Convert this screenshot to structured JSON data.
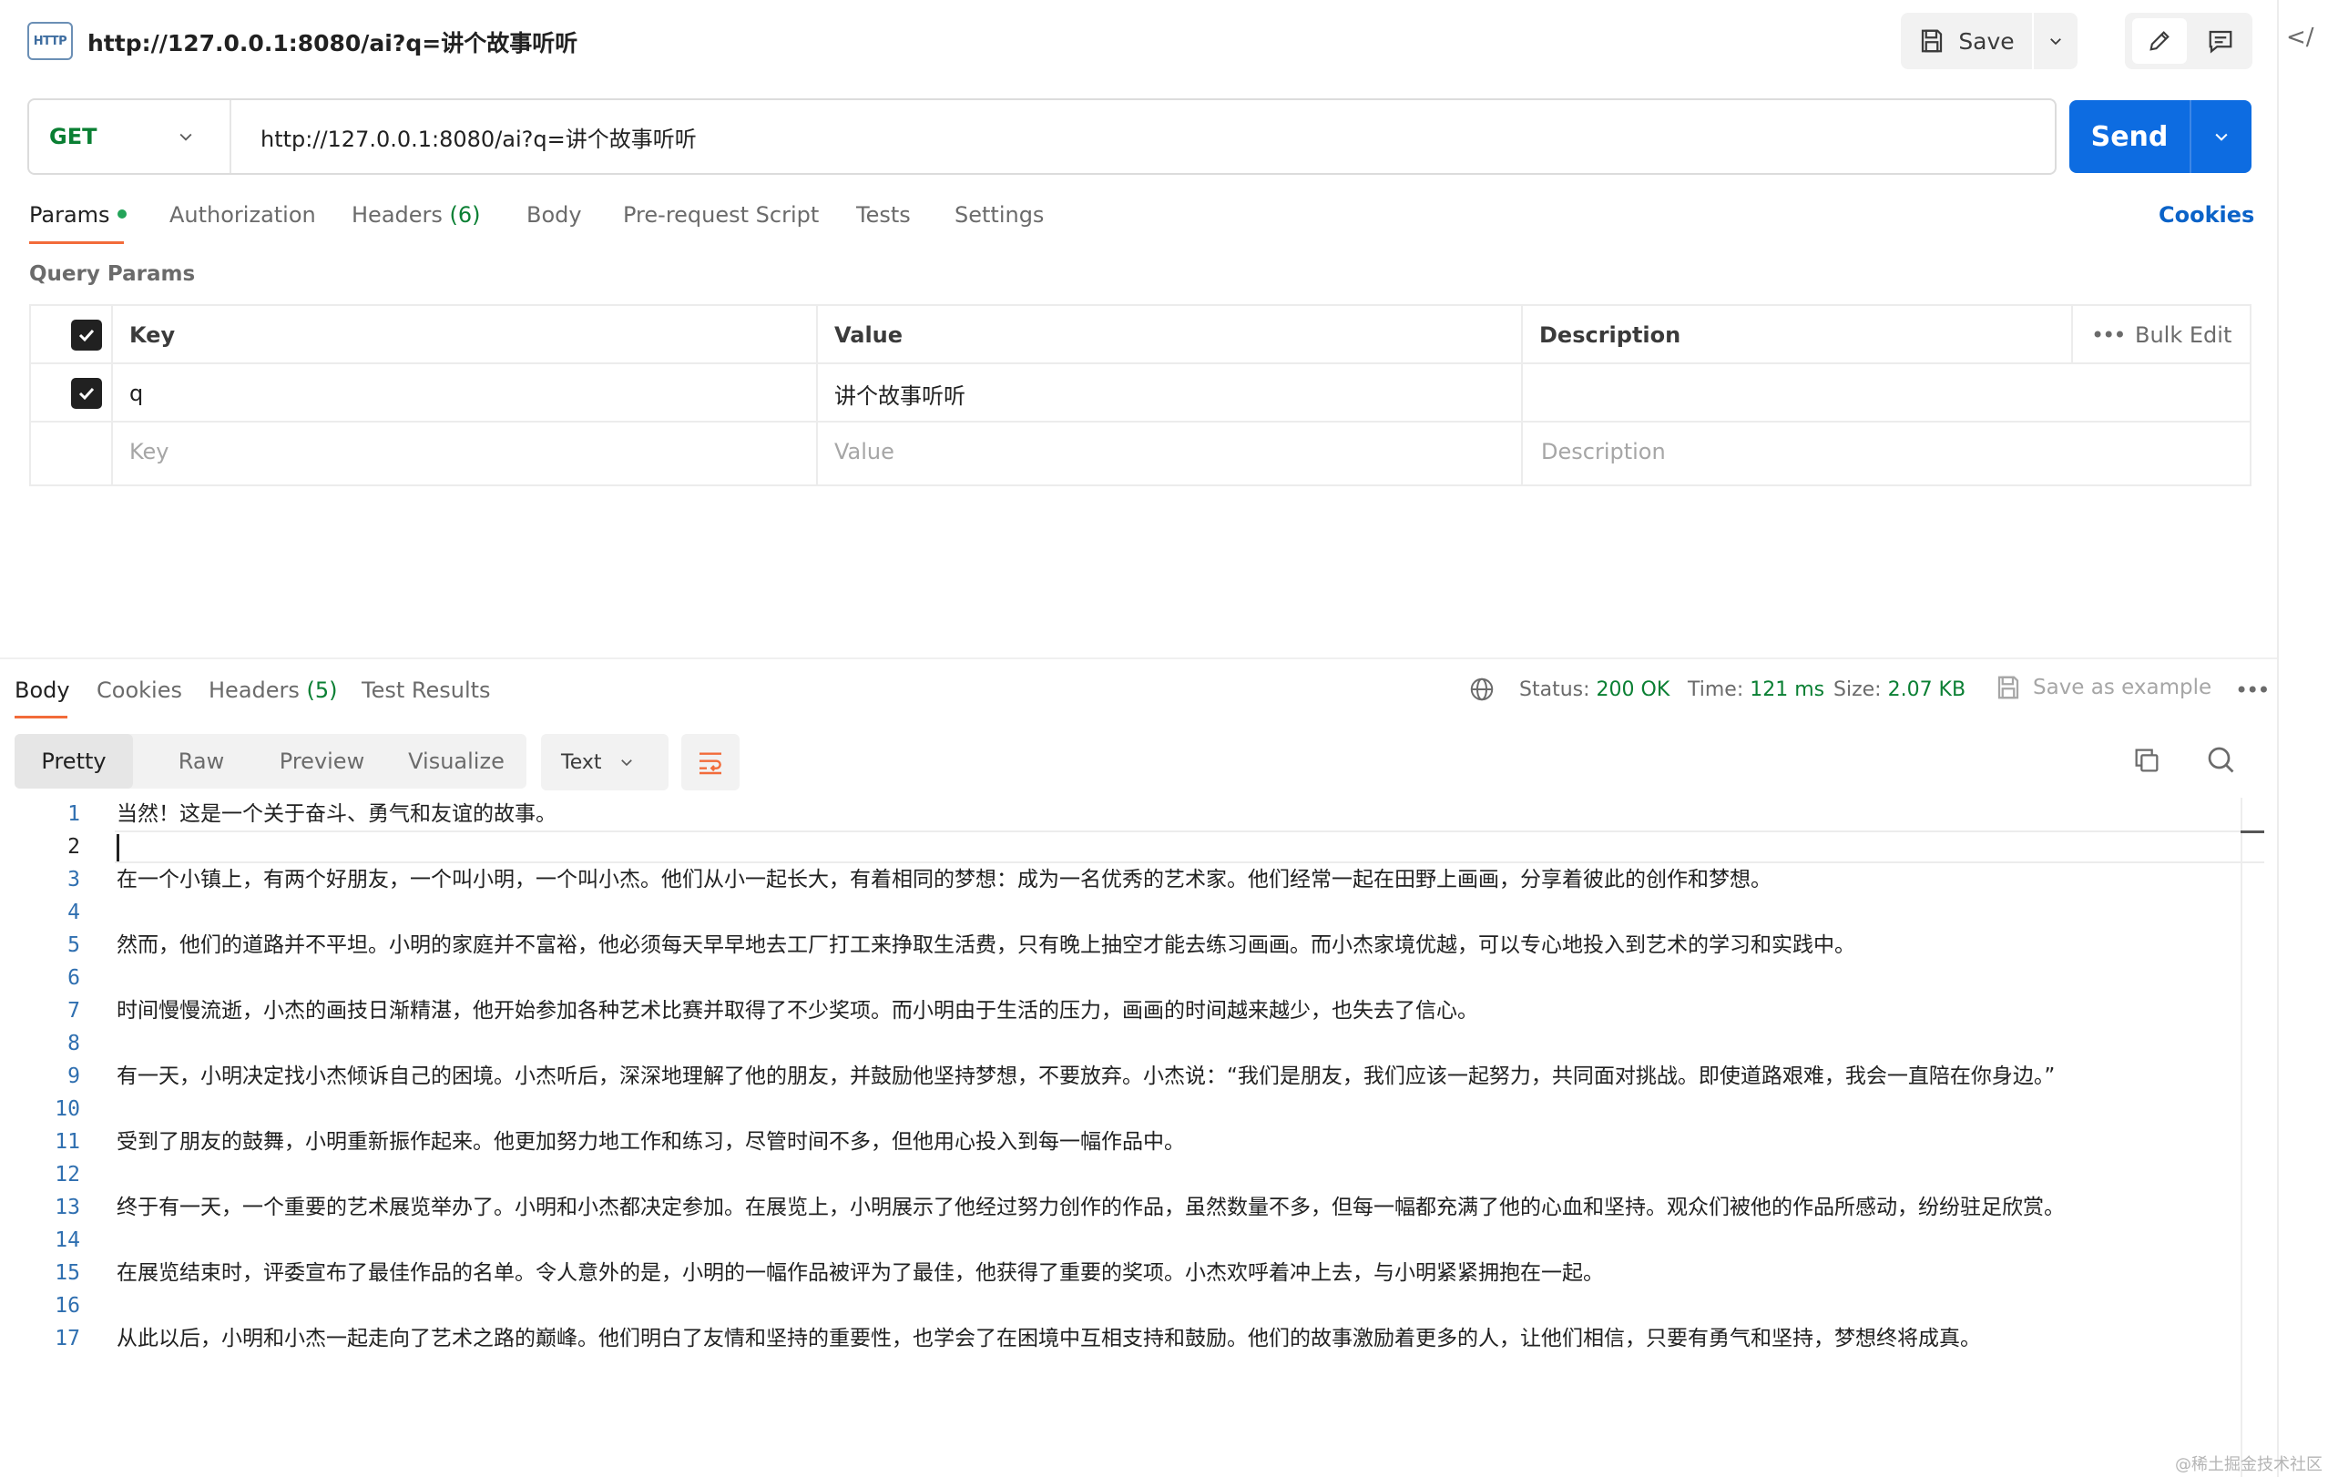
{
  "header": {
    "icon_label": "HTTP",
    "title": "http://127.0.0.1:8080/ai?q=讲个故事听听",
    "save_label": "Save",
    "code_toggle": "</"
  },
  "request": {
    "method": "GET",
    "url": "http://127.0.0.1:8080/ai?q=讲个故事听听",
    "send_label": "Send"
  },
  "request_tabs": {
    "params": "Params",
    "authorization": "Authorization",
    "headers": "Headers",
    "headers_count": "(6)",
    "body": "Body",
    "pre_request": "Pre-request Script",
    "tests": "Tests",
    "settings": "Settings",
    "cookies": "Cookies"
  },
  "query_params": {
    "title": "Query Params",
    "columns": {
      "key": "Key",
      "value": "Value",
      "description": "Description",
      "more": "•••",
      "bulk_edit": "Bulk Edit"
    },
    "rows": [
      {
        "key": "q",
        "value": "讲个故事听听",
        "description": ""
      }
    ],
    "placeholders": {
      "key": "Key",
      "value": "Value",
      "description": "Description"
    }
  },
  "response_tabs": {
    "body": "Body",
    "cookies": "Cookies",
    "headers": "Headers",
    "headers_count": "(5)",
    "test_results": "Test Results"
  },
  "response_status": {
    "status_label": "Status:",
    "status_value": "200 OK",
    "time_label": "Time:",
    "time_value": "121 ms",
    "size_label": "Size:",
    "size_value": "2.07 KB",
    "save_example": "Save as example",
    "more": "•••"
  },
  "format": {
    "pretty": "Pretty",
    "raw": "Raw",
    "preview": "Preview",
    "visualize": "Visualize",
    "type": "Text"
  },
  "body_lines": [
    "当然！这是一个关于奋斗、勇气和友谊的故事。",
    "",
    "在一个小镇上，有两个好朋友，一个叫小明，一个叫小杰。他们从小一起长大，有着相同的梦想：成为一名优秀的艺术家。他们经常一起在田野上画画，分享着彼此的创作和梦想。",
    "",
    "然而，他们的道路并不平坦。小明的家庭并不富裕，他必须每天早早地去工厂打工来挣取生活费，只有晚上抽空才能去练习画画。而小杰家境优越，可以专心地投入到艺术的学习和实践中。",
    "",
    "时间慢慢流逝，小杰的画技日渐精湛，他开始参加各种艺术比赛并取得了不少奖项。而小明由于生活的压力，画画的时间越来越少，也失去了信心。",
    "",
    "有一天，小明决定找小杰倾诉自己的困境。小杰听后，深深地理解了他的朋友，并鼓励他坚持梦想，不要放弃。小杰说：“我们是朋友，我们应该一起努力，共同面对挑战。即使道路艰难，我会一直陪在你身边。”",
    "",
    "受到了朋友的鼓舞，小明重新振作起来。他更加努力地工作和练习，尽管时间不多，但他用心投入到每一幅作品中。",
    "",
    "终于有一天，一个重要的艺术展览举办了。小明和小杰都决定参加。在展览上，小明展示了他经过努力创作的作品，虽然数量不多，但每一幅都充满了他的心血和坚持。观众们被他的作品所感动，纷纷驻足欣赏。",
    "",
    "在展览结束时，评委宣布了最佳作品的名单。令人意外的是，小明的一幅作品被评为了最佳，他获得了重要的奖项。小杰欢呼着冲上去，与小明紧紧拥抱在一起。",
    "",
    "从此以后，小明和小杰一起走向了艺术之路的巅峰。他们明白了友情和坚持的重要性，也学会了在困境中互相支持和鼓励。他们的故事激励着更多的人，让他们相信，只要有勇气和坚持，梦想终将成真。"
  ],
  "watermark": "@稀土掘金技术社区",
  "colors": {
    "accent": "#0d6ce1",
    "method": "#0a7f33",
    "tab_active": "#f26b3a"
  }
}
